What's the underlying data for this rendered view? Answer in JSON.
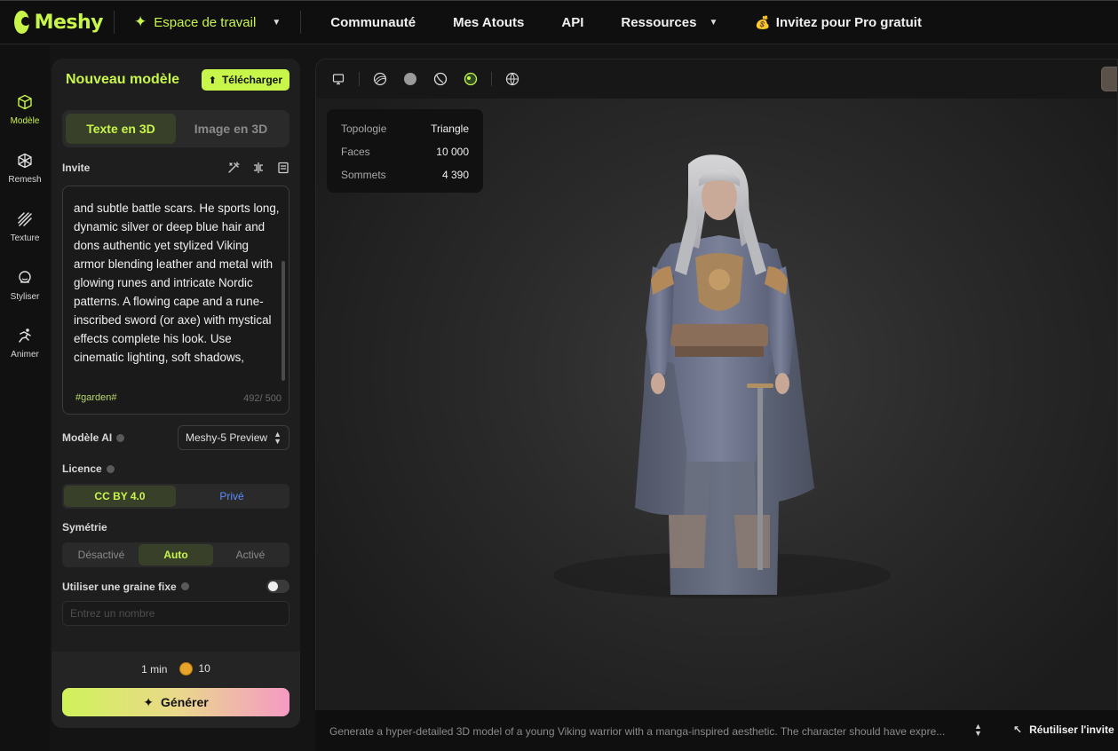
{
  "brand": {
    "name": "Meshy",
    "accent": "#c8f54a"
  },
  "nav": {
    "workspace": "Espace de travail",
    "links": [
      "Communauté",
      "Mes Atouts",
      "API",
      "Ressources"
    ],
    "invite": "Invitez pour Pro gratuit"
  },
  "rail": {
    "items": [
      {
        "label": "Modèle",
        "icon": "cube-icon"
      },
      {
        "label": "Remesh",
        "icon": "remesh-icon"
      },
      {
        "label": "Texture",
        "icon": "texture-icon"
      },
      {
        "label": "Styliser",
        "icon": "stylize-icon"
      },
      {
        "label": "Animer",
        "icon": "running-figure-icon"
      }
    ]
  },
  "panel": {
    "title": "Nouveau modèle",
    "upload_label": "Télécharger",
    "mode_tabs": [
      "Texte en 3D",
      "Image en 3D"
    ],
    "prompt_label": "Invite",
    "prompt_text": "and subtle battle scars. He sports long, dynamic silver or deep blue hair and dons authentic yet stylized Viking armor blending leather and metal with glowing runes and intricate Nordic patterns. A flowing cape and a rune-inscribed sword (or axe) with mystical effects complete his look. Use cinematic lighting, soft shadows,",
    "prompt_tag": "#garden#",
    "prompt_counter": "492/ 500",
    "ai_model_label": "Modèle AI",
    "ai_model_value": "Meshy-5 Preview",
    "license_label": "Licence",
    "license_options": [
      "CC BY 4.0",
      "Privé"
    ],
    "symmetry_label": "Symétrie",
    "symmetry_options": [
      "Désactivé",
      "Auto",
      "Activé"
    ],
    "seed_label": "Utiliser une graine fixe",
    "seed_placeholder": "Entrez un nombre",
    "time": "1 min",
    "credits": "10",
    "generate_label": "Générer"
  },
  "viewer": {
    "stats": [
      {
        "key": "Topologie",
        "value": "Triangle"
      },
      {
        "key": "Faces",
        "value": "10 000"
      },
      {
        "key": "Sommets",
        "value": "4 390"
      }
    ],
    "bottom_prompt": "Generate a hyper-detailed 3D model of a young Viking warrior with a manga-inspired aesthetic. The character should have expre...",
    "reuse_label": "Réutiliser l'invite"
  }
}
